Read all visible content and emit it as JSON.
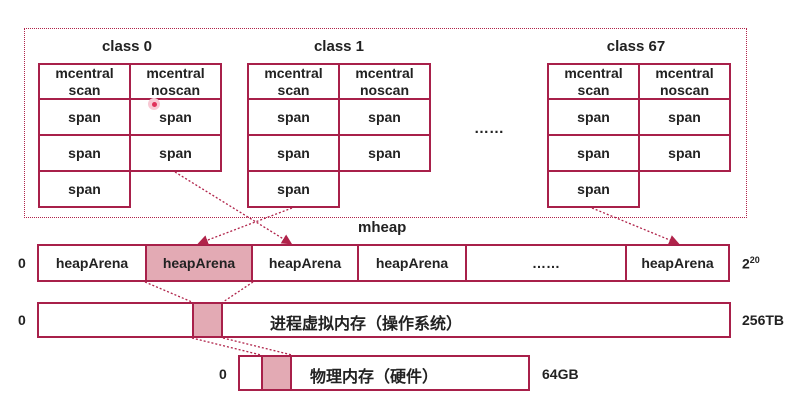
{
  "classes": [
    {
      "title": "class 0",
      "header": [
        "mcentral\nscan",
        "mcentral\nnoscan"
      ],
      "rows": [
        [
          "span",
          "span"
        ],
        [
          "span",
          "span"
        ],
        [
          "span",
          ""
        ]
      ]
    },
    {
      "title": "class 1",
      "header": [
        "mcentral\nscan",
        "mcentral\nnoscan"
      ],
      "rows": [
        [
          "span",
          "span"
        ],
        [
          "span",
          "span"
        ],
        [
          "span",
          ""
        ]
      ]
    },
    {
      "title": "class 67",
      "header": [
        "mcentral\nscan",
        "mcentral\nnoscan"
      ],
      "rows": [
        [
          "span",
          "span"
        ],
        [
          "span",
          "span"
        ],
        [
          "span",
          ""
        ]
      ]
    }
  ],
  "class_ellipsis": "……",
  "mheap": {
    "title": "mheap",
    "start": "0",
    "end_base": "2",
    "end_exp": "20",
    "arenas": [
      "heapArena",
      "heapArena",
      "heapArena",
      "heapArena",
      "……",
      "heapArena"
    ]
  },
  "virtual_memory": {
    "start": "0",
    "label": "进程虚拟内存（操作系统）",
    "end": "256TB"
  },
  "physical_memory": {
    "start": "0",
    "label": "物理内存（硬件）",
    "end": "64GB"
  },
  "colors": {
    "accent": "#a8204a",
    "highlight": "#e3aab4"
  }
}
